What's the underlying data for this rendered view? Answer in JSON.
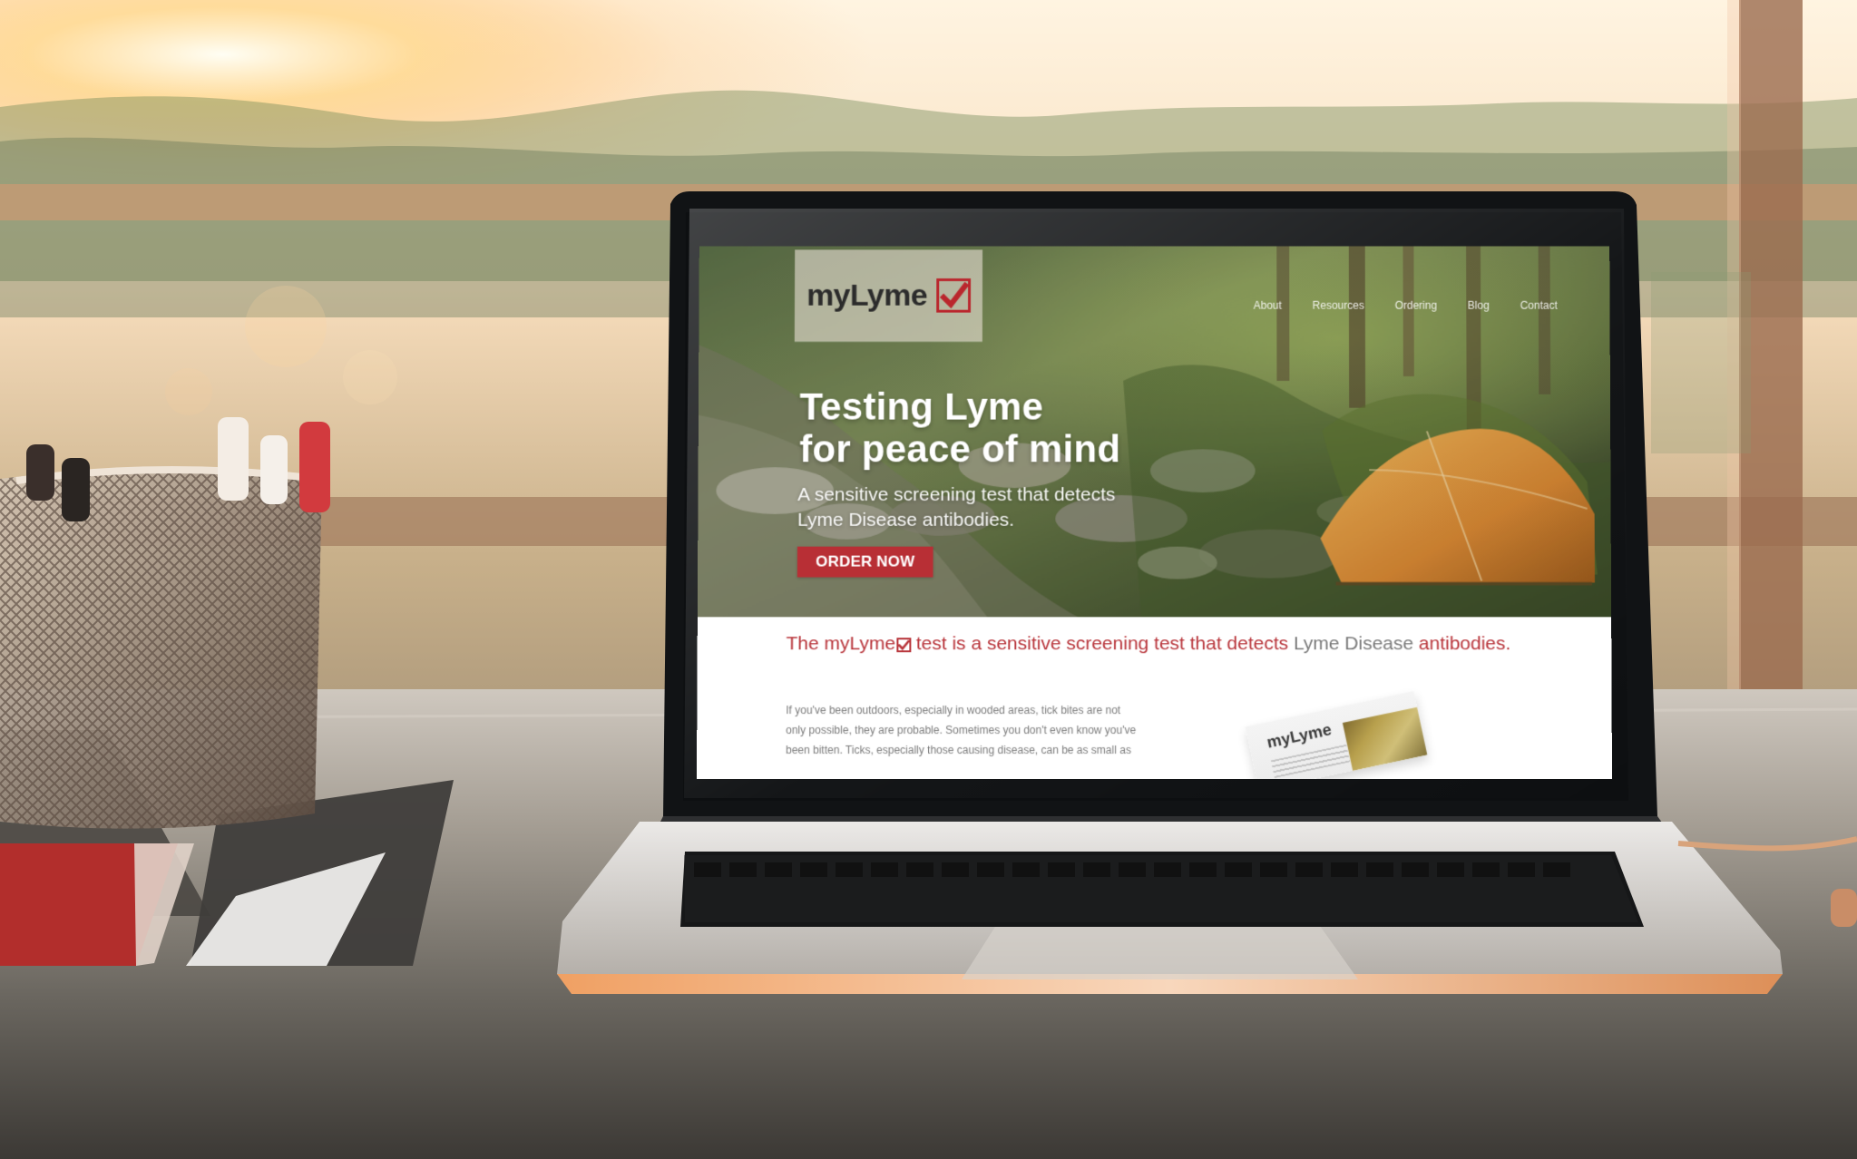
{
  "site": {
    "brand_name": "myLyme",
    "nav": [
      "About",
      "Resources",
      "Ordering",
      "Blog",
      "Contact"
    ],
    "hero": {
      "title_line_1": "Testing Lyme",
      "title_line_2": "for peace of mind",
      "subtitle_line_1": "A sensitive screening test that detects",
      "subtitle_line_2": "Lyme Disease antibodies.",
      "cta_label": "ORDER NOW"
    },
    "intro": {
      "prefix": "The ",
      "brand": "myLyme",
      "middle": " test is a sensitive screening test that detects ",
      "highlight": "Lyme Disease",
      "suffix": " antibodies."
    },
    "body": {
      "line_1": "If you've been outdoors, especially in wooded areas, tick bites are not",
      "line_2": "only possible, they are probable. Sometimes you don't even know you've",
      "line_3": "been bitten. Ticks, especially those causing disease, can be as small as"
    },
    "kit": {
      "brand": "myLyme"
    }
  },
  "colors": {
    "accent": "#b82f35",
    "brand_text": "#2c2c2c",
    "body_text": "#7b7b7b",
    "intro_text": "#b8343a"
  },
  "icons": {
    "brand_mark": "checkbox-check-icon",
    "inline_brand_mark": "checkbox-check-icon"
  }
}
